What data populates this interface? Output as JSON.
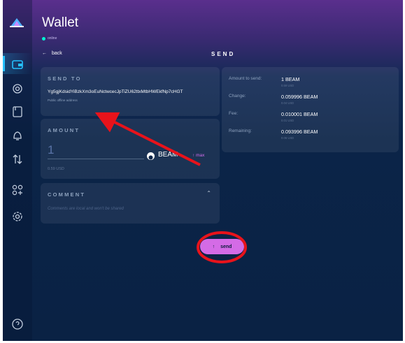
{
  "app": {
    "title": "Wallet",
    "status": "online"
  },
  "nav": {
    "back_label": "back",
    "page_heading": "SEND"
  },
  "send_to": {
    "label": "SEND TO",
    "address": "Yg5gjKdsidYiBzkXm3oEuNctwcecJpTiZU62ttxMtbHWEkfNp7cHGT",
    "address_type": "Public offline address"
  },
  "amount": {
    "label": "AMOUNT",
    "value": "1",
    "currency": "BEAM",
    "max_label": "max",
    "usd": "0.59 USD"
  },
  "comment": {
    "label": "COMMENT",
    "placeholder": "Comments are local and won't be shared"
  },
  "summary": {
    "rows": [
      {
        "label": "Amount to send:",
        "value": "1 BEAM",
        "usd": "0.59 USD"
      },
      {
        "label": "Change:",
        "value": "0.059996 BEAM",
        "usd": "0.04 USD"
      },
      {
        "label": "Fee:",
        "value": "0.010001 BEAM",
        "usd": "0.01 USD"
      },
      {
        "label": "Remaining:",
        "value": "0.093996 BEAM",
        "usd": "0.06 USD"
      }
    ]
  },
  "actions": {
    "send_label": "send"
  },
  "icons": {
    "logo": "beam-logo-icon",
    "sidebar": [
      "wallet-icon",
      "atomic-swap-icon",
      "addresses-icon",
      "notifications-icon",
      "utxo-icon",
      "dapps-icon",
      "settings-icon",
      "help-icon"
    ]
  },
  "colors": {
    "accent": "#25c1ff",
    "send": "#d46be6",
    "online": "#00f6d2",
    "annotation": "#e8131b"
  }
}
